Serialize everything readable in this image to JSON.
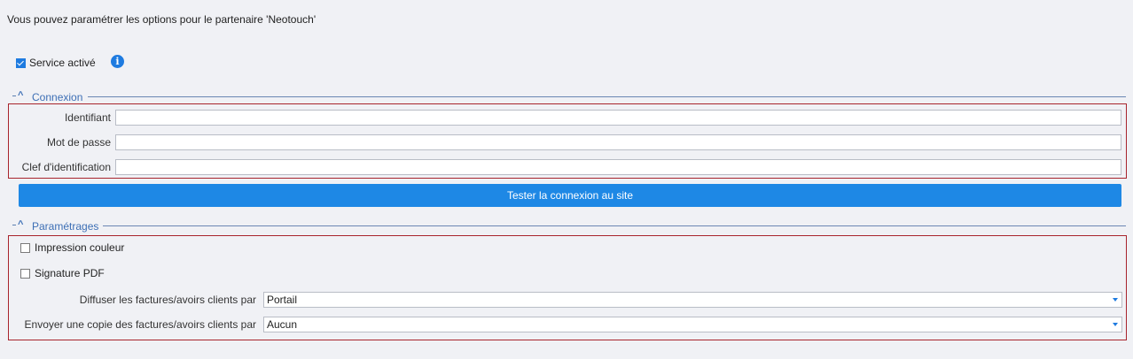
{
  "intro_text": "Vous pouvez paramétrer les options pour le partenaire 'Neotouch'",
  "service": {
    "label": "Service activé",
    "checked": true,
    "info_icon": "info-icon"
  },
  "connexion": {
    "title": "Connexion",
    "fields": [
      {
        "label": "Identifiant",
        "value": ""
      },
      {
        "label": "Mot de passe",
        "value": ""
      },
      {
        "label": "Clef d'identification",
        "value": ""
      }
    ],
    "test_button": "Tester la connexion au site"
  },
  "parametrages": {
    "title": "Paramétrages",
    "checkboxes": [
      {
        "label": "Impression couleur",
        "checked": false
      },
      {
        "label": "Signature PDF",
        "checked": false
      }
    ],
    "selects": [
      {
        "label": "Diffuser les factures/avoirs clients par",
        "value": "Portail"
      },
      {
        "label": "Envoyer une copie des factures/avoirs clients par",
        "value": "Aucun"
      }
    ]
  },
  "colors": {
    "accent": "#1e88e5",
    "highlight_border": "#a8242c",
    "section_title": "#3d6fb5"
  }
}
